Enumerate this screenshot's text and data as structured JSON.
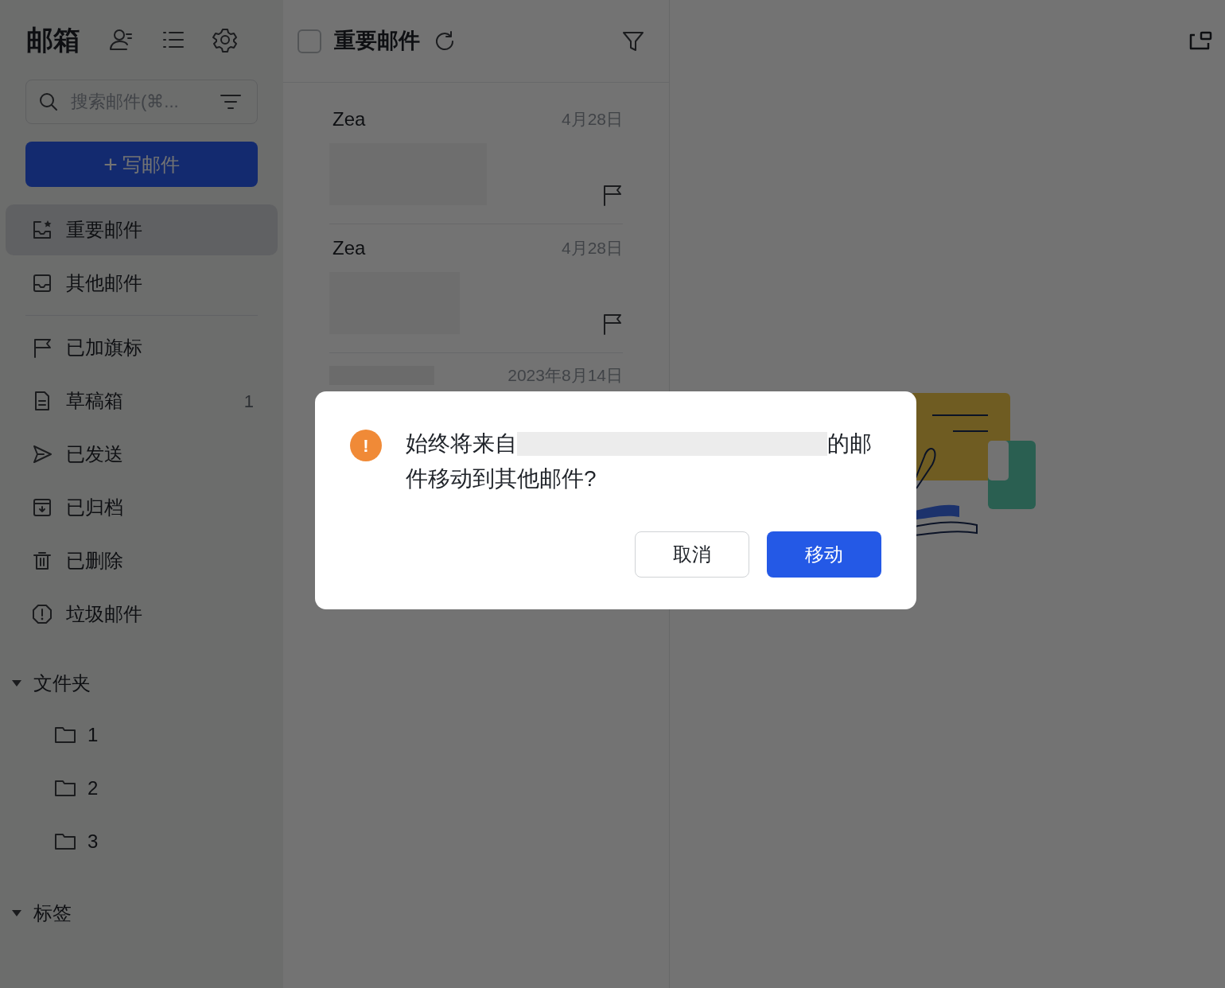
{
  "sidebar": {
    "title": "邮箱",
    "search": {
      "placeholder": "搜索邮件(⌘..."
    },
    "compose_button": "写邮件",
    "compose_icon": "+",
    "mailboxes": [
      {
        "kind": "important",
        "label": "重要邮件",
        "selected": true
      },
      {
        "kind": "inbox",
        "label": "其他邮件",
        "selected": false
      }
    ],
    "system_folders": [
      {
        "kind": "flagged",
        "label": "已加旗标",
        "selected": false
      },
      {
        "kind": "drafts",
        "label": "草稿箱",
        "count": "1",
        "selected": false
      },
      {
        "kind": "sent",
        "label": "已发送",
        "selected": false
      },
      {
        "kind": "archived",
        "label": "已归档",
        "selected": false
      },
      {
        "kind": "deleted",
        "label": "已删除",
        "selected": false
      },
      {
        "kind": "spam",
        "label": "垃圾邮件",
        "selected": false
      }
    ],
    "sections": [
      {
        "title": "文件夹",
        "expanded": true,
        "items": [
          {
            "label": "1"
          },
          {
            "label": "2"
          },
          {
            "label": "3"
          }
        ]
      },
      {
        "title": "标签",
        "expanded": true
      }
    ]
  },
  "mail_list": {
    "title": "重要邮件",
    "select_all_checked": false,
    "messages": [
      {
        "sender": "Zea",
        "date": "4月28日"
      },
      {
        "sender": "Zea",
        "date": "4月28日"
      },
      {
        "date": "2023年8月14日"
      }
    ]
  },
  "dialog": {
    "message_start": "始终将来自",
    "message_line1_end": "的邮",
    "message_line2": "件移动到其他邮件?",
    "icon": "!",
    "buttons": [
      {
        "label": "取消",
        "primary": false
      },
      {
        "label": "移动",
        "primary": true
      }
    ]
  }
}
